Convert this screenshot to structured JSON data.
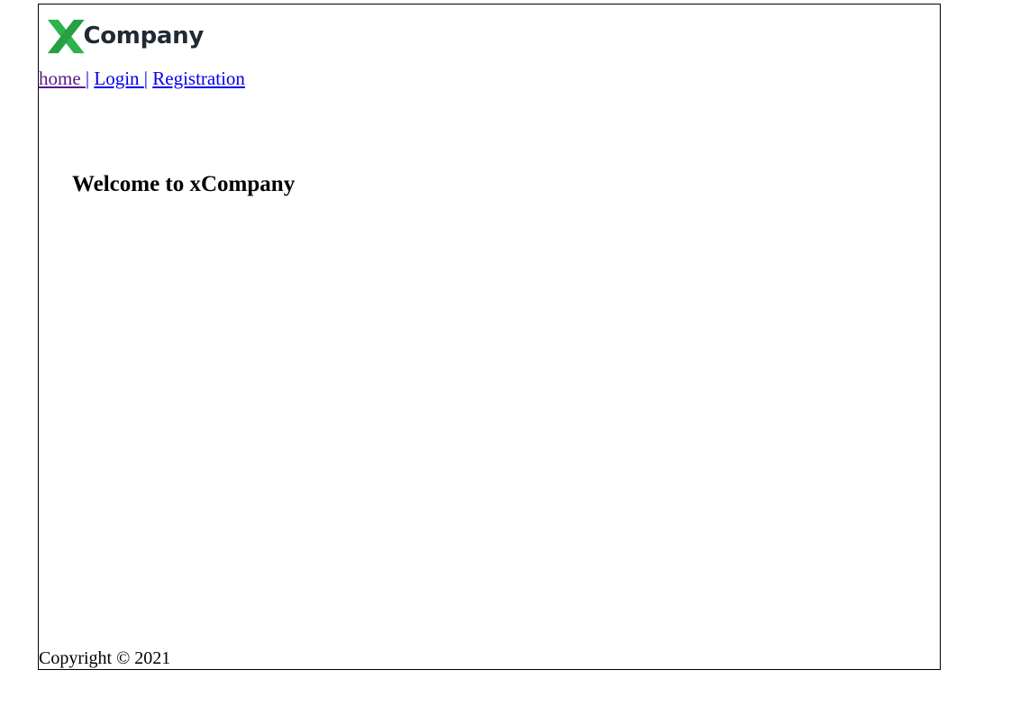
{
  "logo": {
    "text": "Company",
    "icon": "x-logo-icon",
    "accent_color": "#2db34a"
  },
  "nav": {
    "items": [
      {
        "label": "home ",
        "visited": true
      },
      {
        "label": "Login ",
        "visited": false
      },
      {
        "label": "Registration",
        "visited": false
      }
    ],
    "separator": "|"
  },
  "main": {
    "heading": "Welcome to xCompany"
  },
  "footer": {
    "copyright": "Copyright © 2021"
  }
}
